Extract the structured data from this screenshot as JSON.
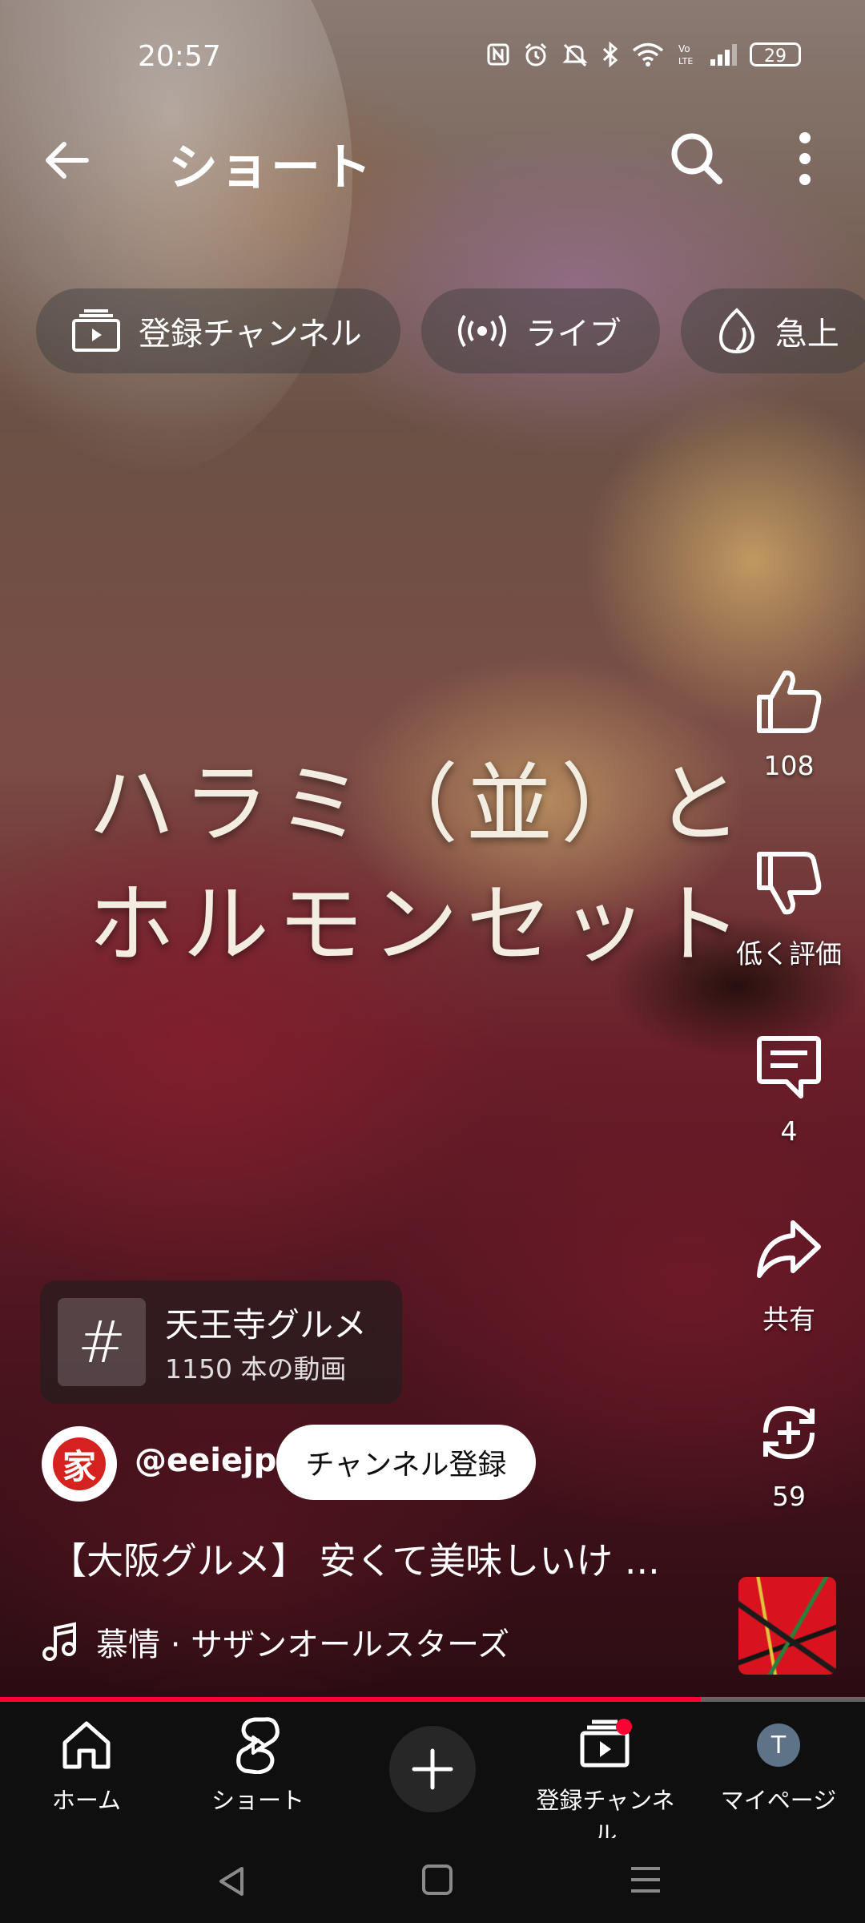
{
  "status": {
    "time": "20:57",
    "battery": "29"
  },
  "header": {
    "title": "ショート"
  },
  "chips": [
    {
      "label": "登録チャンネル",
      "icon": "subscriptions-icon"
    },
    {
      "label": "ライブ",
      "icon": "live-icon"
    },
    {
      "label": "急上",
      "icon": "trending-icon"
    }
  ],
  "overlay": {
    "line1": "ハラミ（並）と",
    "line2": "ホルモンセット"
  },
  "actions": {
    "like": "108",
    "dislike": "低く評価",
    "comments": "4",
    "share": "共有",
    "remix": "59"
  },
  "hashtag": {
    "symbol": "#",
    "title": "天王寺グルメ",
    "count": "1150 本の動画"
  },
  "channel": {
    "handle": "@eeiejp",
    "avatar_text": "家",
    "subscribe": "チャンネル登録"
  },
  "video": {
    "title": "【大阪グルメ】 安くて美味しいけ ..."
  },
  "music": {
    "label": "慕情 · サザンオールスターズ"
  },
  "progress": {
    "percent": 81
  },
  "nav": {
    "home": "ホーム",
    "shorts": "ショート",
    "subscriptions": "登録チャンネル",
    "mypage": "マイページ",
    "avatar_letter": "T"
  },
  "colors": {
    "accent": "#ff0033",
    "background": "#0f0f0f"
  }
}
